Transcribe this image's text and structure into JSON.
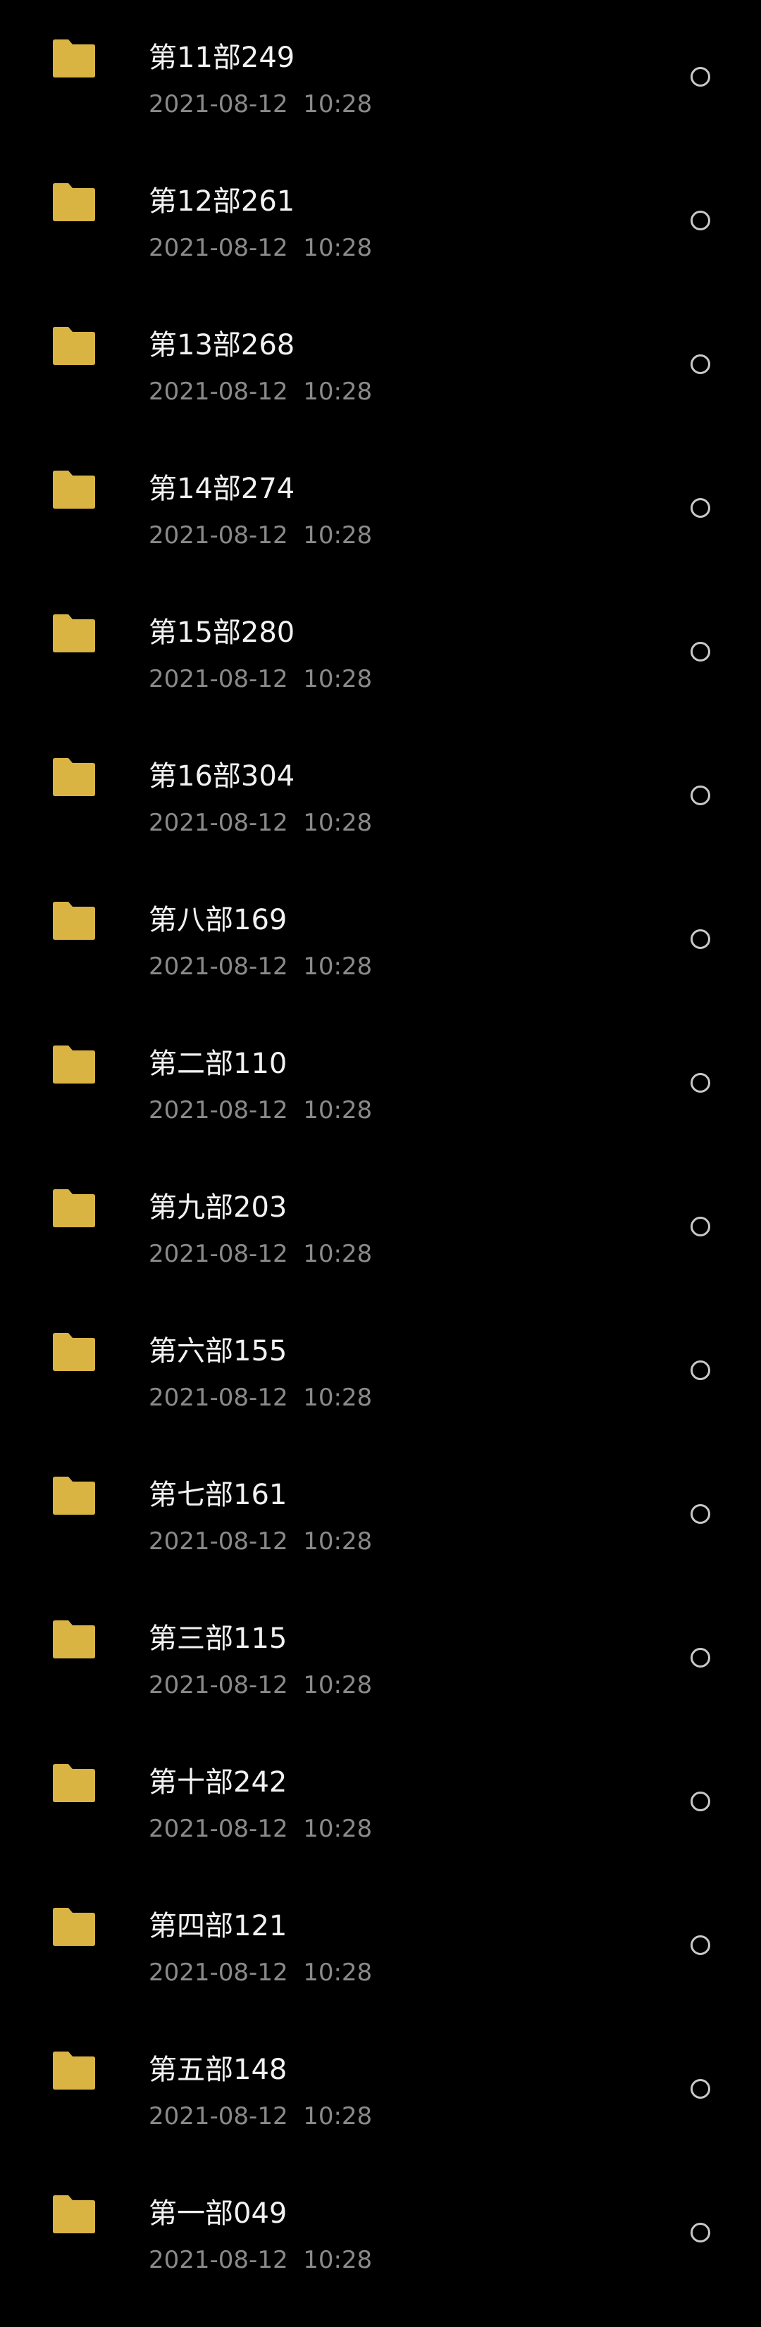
{
  "colors": {
    "background": "#000000",
    "folder": "#d9b443",
    "name_text": "#f2f2f2",
    "date_text": "#8a8a8a",
    "radio_border": "#c8c8c8"
  },
  "folder_list": {
    "icon": "folder-icon",
    "select_icon": "radio-unchecked-icon",
    "items": [
      {
        "name": "第11部249",
        "date": "2021-08-12  10:28"
      },
      {
        "name": "第12部261",
        "date": "2021-08-12  10:28"
      },
      {
        "name": "第13部268",
        "date": "2021-08-12  10:28"
      },
      {
        "name": "第14部274",
        "date": "2021-08-12  10:28"
      },
      {
        "name": "第15部280",
        "date": "2021-08-12  10:28"
      },
      {
        "name": "第16部304",
        "date": "2021-08-12  10:28"
      },
      {
        "name": "第八部169",
        "date": "2021-08-12  10:28"
      },
      {
        "name": "第二部110",
        "date": "2021-08-12  10:28"
      },
      {
        "name": "第九部203",
        "date": "2021-08-12  10:28"
      },
      {
        "name": "第六部155",
        "date": "2021-08-12  10:28"
      },
      {
        "name": "第七部161",
        "date": "2021-08-12  10:28"
      },
      {
        "name": "第三部115",
        "date": "2021-08-12  10:28"
      },
      {
        "name": "第十部242",
        "date": "2021-08-12  10:28"
      },
      {
        "name": "第四部121",
        "date": "2021-08-12  10:28"
      },
      {
        "name": "第五部148",
        "date": "2021-08-12  10:28"
      },
      {
        "name": "第一部049",
        "date": "2021-08-12  10:28"
      }
    ]
  }
}
